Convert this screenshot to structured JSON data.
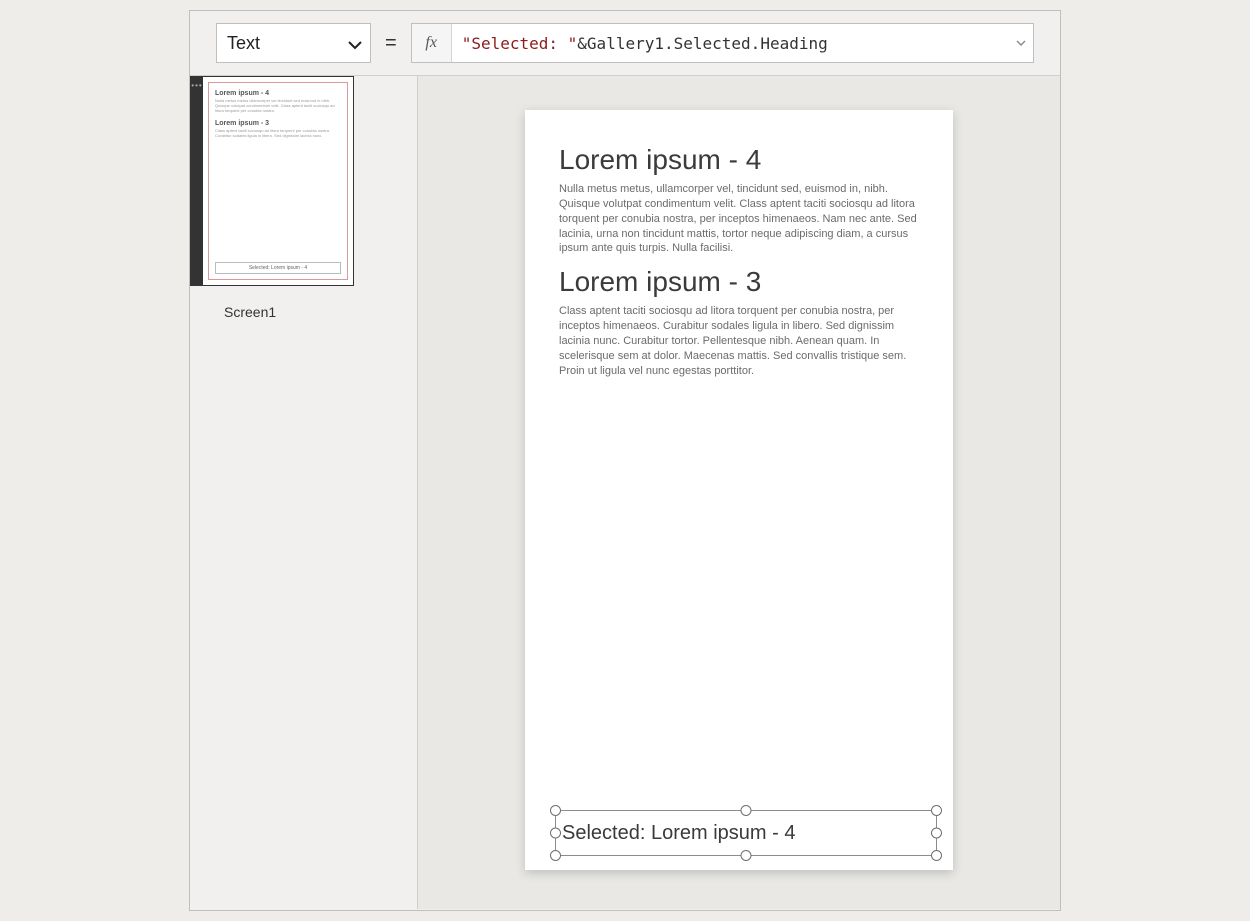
{
  "formula_bar": {
    "property": "Text",
    "equals": "=",
    "fx_label": "fx",
    "expr_string": "\"Selected: \"",
    "expr_op": " & ",
    "expr_id": "Gallery1.Selected.Heading"
  },
  "nav": {
    "screen_label": "Screen1",
    "thumb": {
      "h1": "Lorem ipsum - 4",
      "p1": "Nulla metus metus ullamcorper vel tincidunt sed euismod in nibh. Quisque volutpat condimentum velit. Class aptent taciti sociosqu ad litora torquent per conubia nostra.",
      "h2": "Lorem ipsum - 3",
      "p2": "Class aptent taciti sociosqu ad litora torquent per conubia nostra. Curabitur sodales ligula in libero. Sed dignissim lacinia nunc.",
      "selected": "Selected: Lorem ipsum - 4"
    }
  },
  "canvas": {
    "items": [
      {
        "heading": "Lorem ipsum - 4",
        "body": "Nulla metus metus, ullamcorper vel, tincidunt sed, euismod in, nibh. Quisque volutpat condimentum velit. Class aptent taciti sociosqu ad litora torquent per conubia nostra, per inceptos himenaeos. Nam nec ante. Sed lacinia, urna non tincidunt mattis, tortor neque adipiscing diam, a cursus ipsum ante quis turpis. Nulla facilisi."
      },
      {
        "heading": "Lorem ipsum - 3",
        "body": "Class aptent taciti sociosqu ad litora torquent per conubia nostra, per inceptos himenaeos. Curabitur sodales ligula in libero. Sed dignissim lacinia nunc. Curabitur tortor. Pellentesque nibh. Aenean quam. In scelerisque sem at dolor. Maecenas mattis. Sed convallis tristique sem. Proin ut ligula vel nunc egestas porttitor."
      }
    ],
    "selected_label": "Selected: Lorem ipsum - 4"
  }
}
